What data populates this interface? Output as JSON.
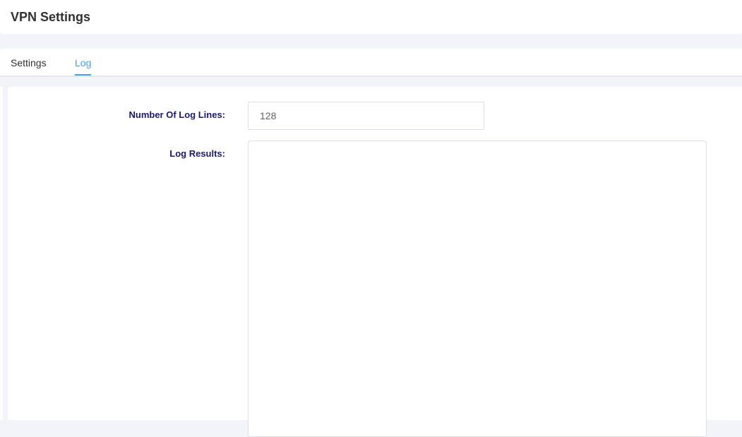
{
  "header": {
    "title": "VPN Settings"
  },
  "tabs": [
    {
      "label": "Settings",
      "active": false
    },
    {
      "label": "Log",
      "active": true
    }
  ],
  "form": {
    "log_lines_label": "Number Of Log Lines:",
    "log_lines_value": "128",
    "log_results_label": "Log Results:",
    "log_results_value": ""
  },
  "colors": {
    "accent": "#409eff",
    "label_text": "#1a1a6e",
    "background": "#f2f4f7"
  }
}
